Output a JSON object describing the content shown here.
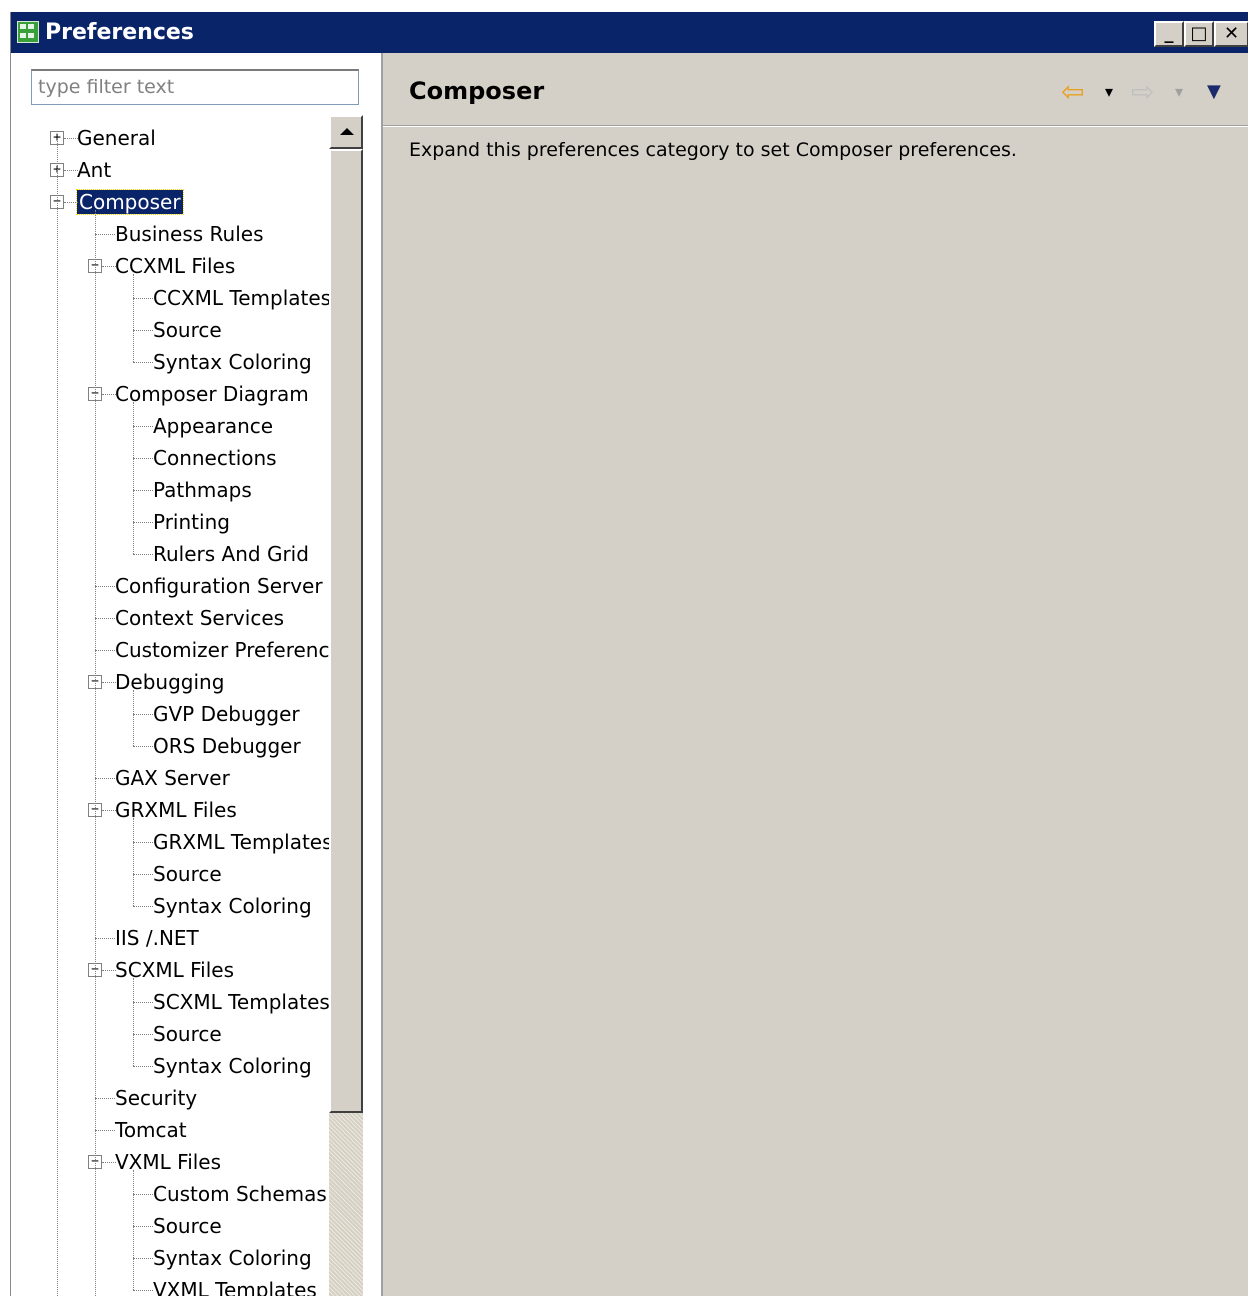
{
  "window": {
    "title": "Preferences",
    "min_symbol": "_",
    "max_symbol": "□",
    "close_symbol": "✕"
  },
  "filter": {
    "placeholder": "type filter text"
  },
  "tree": [
    {
      "label": "General",
      "level": 0,
      "expander": "+"
    },
    {
      "label": "Ant",
      "level": 0,
      "expander": "+"
    },
    {
      "label": "Composer",
      "level": 0,
      "expander": "−",
      "selected": true
    },
    {
      "label": "Business Rules",
      "level": 1
    },
    {
      "label": "CCXML Files",
      "level": 1,
      "expander": "−"
    },
    {
      "label": "CCXML Templates",
      "level": 2
    },
    {
      "label": "Source",
      "level": 2
    },
    {
      "label": "Syntax Coloring",
      "level": 2
    },
    {
      "label": "Composer Diagram",
      "level": 1,
      "expander": "−"
    },
    {
      "label": "Appearance",
      "level": 2
    },
    {
      "label": "Connections",
      "level": 2
    },
    {
      "label": "Pathmaps",
      "level": 2
    },
    {
      "label": "Printing",
      "level": 2
    },
    {
      "label": "Rulers And Grid",
      "level": 2
    },
    {
      "label": "Configuration Server",
      "level": 1
    },
    {
      "label": "Context Services",
      "level": 1
    },
    {
      "label": "Customizer Preference",
      "level": 1
    },
    {
      "label": "Debugging",
      "level": 1,
      "expander": "−"
    },
    {
      "label": "GVP Debugger",
      "level": 2
    },
    {
      "label": "ORS Debugger",
      "level": 2
    },
    {
      "label": "GAX Server",
      "level": 1
    },
    {
      "label": "GRXML Files",
      "level": 1,
      "expander": "−"
    },
    {
      "label": "GRXML Templates",
      "level": 2
    },
    {
      "label": "Source",
      "level": 2
    },
    {
      "label": "Syntax Coloring",
      "level": 2
    },
    {
      "label": "IIS /.NET",
      "level": 1
    },
    {
      "label": "SCXML Files",
      "level": 1,
      "expander": "−"
    },
    {
      "label": "SCXML Templates",
      "level": 2
    },
    {
      "label": "Source",
      "level": 2
    },
    {
      "label": "Syntax Coloring",
      "level": 2
    },
    {
      "label": "Security",
      "level": 1
    },
    {
      "label": "Tomcat",
      "level": 1
    },
    {
      "label": "VXML Files",
      "level": 1,
      "expander": "−"
    },
    {
      "label": "Custom Schemas C",
      "level": 2
    },
    {
      "label": "Source",
      "level": 2
    },
    {
      "label": "Syntax Coloring",
      "level": 2
    },
    {
      "label": "VXML Templates",
      "level": 2
    }
  ],
  "page": {
    "title": "Composer",
    "description": "Expand this preferences category to set Composer preferences.",
    "back_icon": "⇦",
    "forward_icon": "⇨",
    "dropdown_icon": "▾",
    "menu_icon": "▼"
  },
  "colors": {
    "titlebar": "#0a246a",
    "selection": "#0a246a",
    "dialog_bg": "#d4d0c8",
    "back_arrow": "#e8a020"
  }
}
